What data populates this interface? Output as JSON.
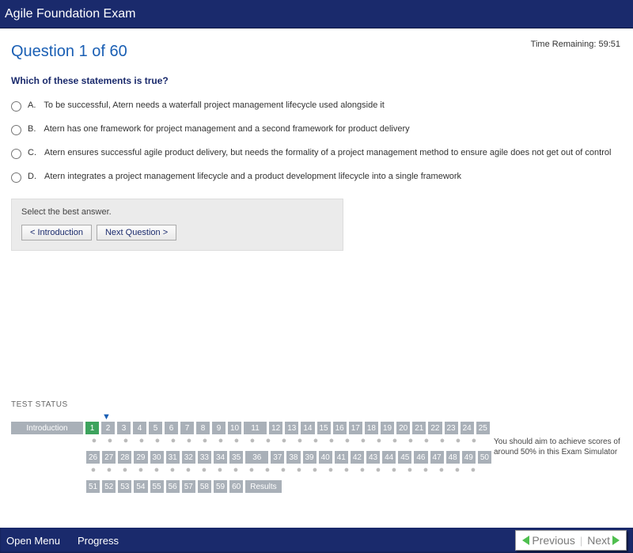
{
  "header": {
    "title": "Agile Foundation Exam"
  },
  "timer": {
    "label": "Time Remaining:",
    "value": "59:51"
  },
  "question": {
    "counter": "Question 1 of 60",
    "prompt": "Which of these statements is true?",
    "answers": [
      {
        "letter": "A.",
        "text": "To be successful, Atern needs a waterfall project management lifecycle used alongside it"
      },
      {
        "letter": "B.",
        "text": "Atern has one framework for project management and a second framework for product delivery"
      },
      {
        "letter": "C.",
        "text": "Atern ensures successful agile product delivery, but needs the formality of a project management method to ensure agile does not get out of control"
      },
      {
        "letter": "D.",
        "text": "Atern integrates a project management lifecycle and a product development lifecycle into a single framework"
      }
    ],
    "instruction": "Select the best answer.",
    "buttons": {
      "prev": "< Introduction",
      "next": "Next Question >"
    }
  },
  "status": {
    "label": "TEST STATUS",
    "intro": "Introduction",
    "results": "Results",
    "currentIndex": 1,
    "tip": "You should aim to achieve scores of around 50% in this Exam Simulator"
  },
  "footer": {
    "menu": "Open Menu",
    "progress": "Progress",
    "prev": "Previous",
    "next": "Next"
  }
}
